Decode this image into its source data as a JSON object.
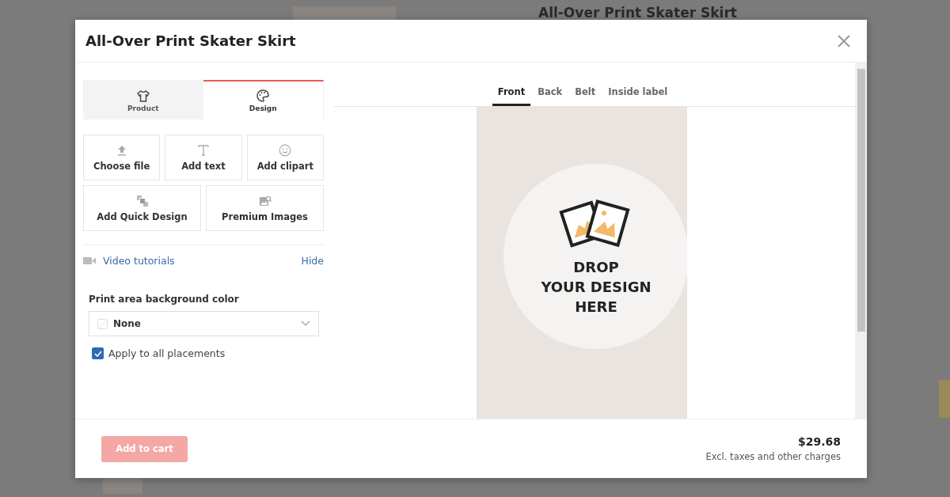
{
  "background_page": {
    "title": "All-Over Print Skater Skirt"
  },
  "modal": {
    "title": "All-Over Print Skater Skirt"
  },
  "side_tabs": [
    {
      "label": "Product",
      "kind": "shirt",
      "selected": false
    },
    {
      "label": "Design",
      "kind": "palette",
      "selected": true
    }
  ],
  "tools": [
    {
      "label": "Choose file",
      "kind": "upload"
    },
    {
      "label": "Add text",
      "kind": "text"
    },
    {
      "label": "Add clipart",
      "kind": "smiley"
    },
    {
      "label": "Add Quick Design",
      "kind": "quick"
    },
    {
      "label": "Premium Images",
      "kind": "image"
    }
  ],
  "tutorials": {
    "label": "Video tutorials",
    "action": "Hide"
  },
  "background_color": {
    "label": "Print area background color",
    "value": "None"
  },
  "apply_all": {
    "label": "Apply to all placements",
    "checked": true
  },
  "placement_tabs": [
    {
      "label": "Front",
      "selected": true
    },
    {
      "label": "Back",
      "selected": false
    },
    {
      "label": "Belt",
      "selected": false
    },
    {
      "label": "Inside label",
      "selected": false
    }
  ],
  "drop_zone": {
    "lines": [
      "DROP",
      "YOUR DESIGN",
      "HERE"
    ]
  },
  "footer": {
    "button": {
      "label": "Add to cart",
      "disabled": true
    },
    "price": "$29.68",
    "note": "Excl. taxes and other charges"
  }
}
